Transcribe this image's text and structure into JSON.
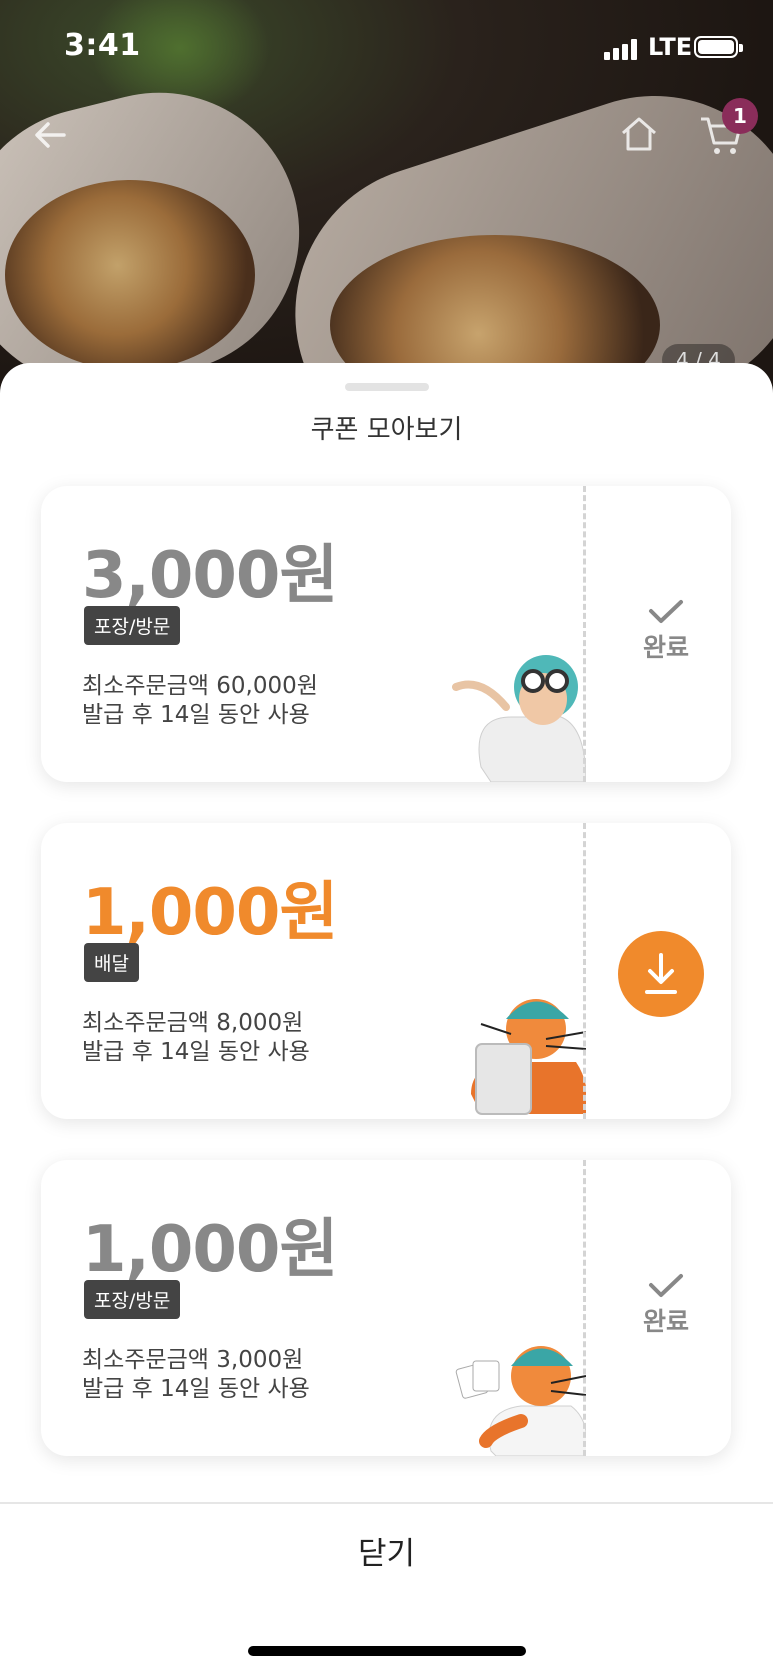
{
  "status_bar": {
    "time": "3:41",
    "network": "LTE"
  },
  "nav": {
    "cart_count": "1",
    "pager": "4 / 4"
  },
  "sheet": {
    "title": "쿠폰 모아보기",
    "close_label": "닫기",
    "coupons": [
      {
        "amount": "3,000원",
        "tag": "포장/방문",
        "min_order": "최소주문금액 60,000원",
        "validity": "발급 후 14일 동안 사용",
        "status": "완료",
        "state": "done"
      },
      {
        "amount": "1,000원",
        "tag": "배달",
        "min_order": "최소주문금액 8,000원",
        "validity": "발급 후 14일 동안 사용",
        "status": "",
        "state": "download"
      },
      {
        "amount": "1,000원",
        "tag": "포장/방문",
        "min_order": "최소주문금액 3,000원",
        "validity": "발급 후 14일 동안 사용",
        "status": "완료",
        "state": "done"
      }
    ]
  },
  "colors": {
    "accent": "#f08a2c",
    "badge": "#8a2d5a",
    "inactive_amount": "#888888"
  }
}
